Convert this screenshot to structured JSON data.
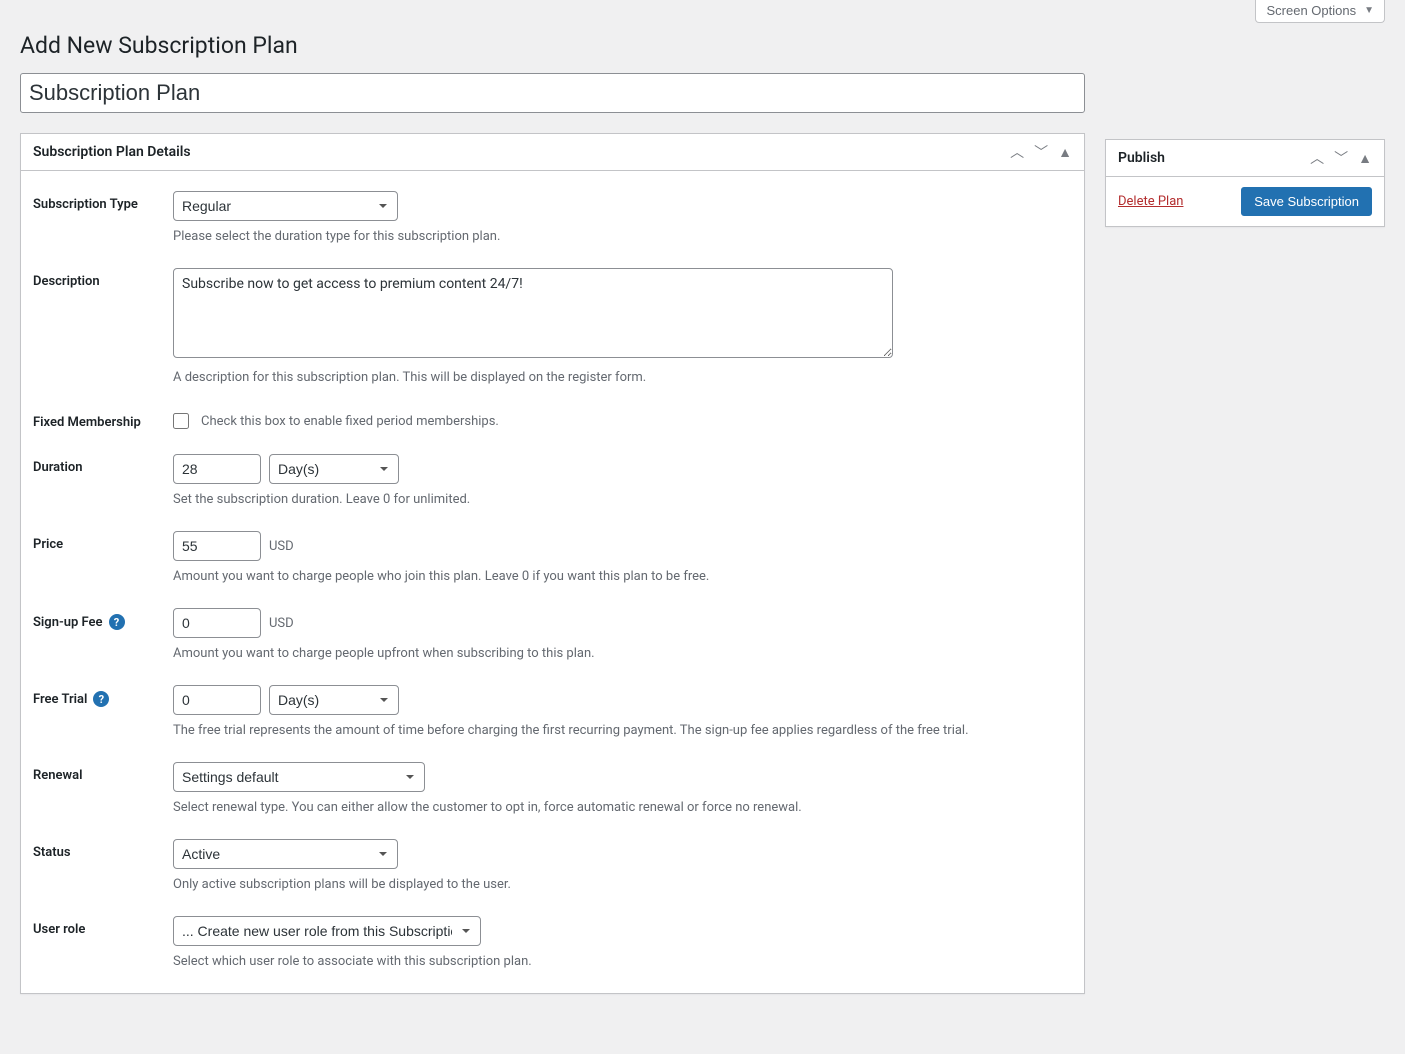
{
  "screen_options_label": "Screen Options",
  "page_title": "Add New Subscription Plan",
  "title_input_value": "Subscription Plan",
  "details_box_title": "Subscription Plan Details",
  "publish_box_title": "Publish",
  "delete_plan_label": "Delete Plan",
  "save_subscription_label": "Save Subscription",
  "fields": {
    "subscription_type": {
      "label": "Subscription Type",
      "value": "Regular",
      "hint": "Please select the duration type for this subscription plan."
    },
    "description": {
      "label": "Description",
      "value": "Subscribe now to get access to premium content 24/7!",
      "hint": "A description for this subscription plan. This will be displayed on the register form."
    },
    "fixed_membership": {
      "label": "Fixed Membership",
      "checkbox_text": "Check this box to enable fixed period memberships."
    },
    "duration": {
      "label": "Duration",
      "value": "28",
      "unit": "Day(s)",
      "hint": "Set the subscription duration. Leave 0 for unlimited."
    },
    "price": {
      "label": "Price",
      "value": "55",
      "currency": "USD",
      "hint": "Amount you want to charge people who join this plan. Leave 0 if you want this plan to be free."
    },
    "signup_fee": {
      "label": "Sign-up Fee",
      "value": "0",
      "currency": "USD",
      "hint": "Amount you want to charge people upfront when subscribing to this plan."
    },
    "free_trial": {
      "label": "Free Trial",
      "value": "0",
      "unit": "Day(s)",
      "hint": "The free trial represents the amount of time before charging the first recurring payment. The sign-up fee applies regardless of the free trial."
    },
    "renewal": {
      "label": "Renewal",
      "value": "Settings default",
      "hint": "Select renewal type. You can either allow the customer to opt in, force automatic renewal or force no renewal."
    },
    "status": {
      "label": "Status",
      "value": "Active",
      "hint": "Only active subscription plans will be displayed to the user."
    },
    "user_role": {
      "label": "User role",
      "value": "... Create new user role from this Subscription Plan",
      "hint": "Select which user role to associate with this subscription plan."
    }
  }
}
